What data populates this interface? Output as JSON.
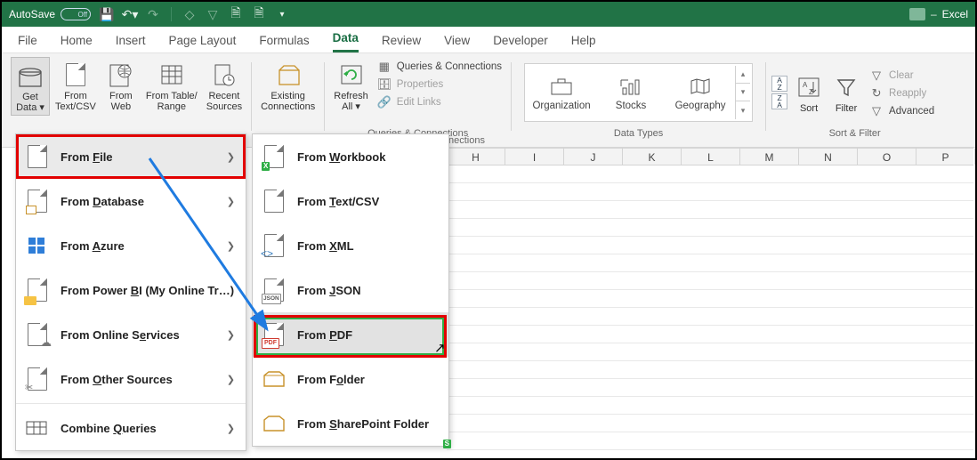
{
  "titlebar": {
    "autosave_label": "AutoSave",
    "autosave_state": "Off",
    "app_name": "Excel"
  },
  "tabs": [
    "File",
    "Home",
    "Insert",
    "Page Layout",
    "Formulas",
    "Data",
    "Review",
    "View",
    "Developer",
    "Help"
  ],
  "active_tab_index": 5,
  "ribbon": {
    "get_transform": {
      "get_data": "Get\nData ▾",
      "from_textcsv": "From\nText/CSV",
      "from_web": "From\nWeb",
      "from_table": "From Table/\nRange",
      "recent_sources": "Recent\nSources",
      "existing_conn": "Existing\nConnections"
    },
    "refresh": {
      "refresh_all": "Refresh\nAll ▾",
      "queries": "Queries & Connections",
      "properties": "Properties",
      "edit_links": "Edit Links",
      "caption": "Queries & Connections"
    },
    "data_types": {
      "items": [
        {
          "label": "Organization"
        },
        {
          "label": "Stocks"
        },
        {
          "label": "Geography"
        }
      ],
      "caption": "Data Types"
    },
    "sort_filter": {
      "sort": "Sort",
      "filter": "Filter",
      "clear": "Clear",
      "reapply": "Reapply",
      "advanced": "Advanced",
      "caption": "Sort & Filter"
    },
    "connections_caption": "nections"
  },
  "cols": [
    "H",
    "I",
    "J",
    "K",
    "L",
    "M",
    "N",
    "O",
    "P"
  ],
  "menu1": [
    {
      "label_pre": "From ",
      "u": "F",
      "label_post": "ile",
      "chev": true,
      "hl": true
    },
    {
      "label_pre": "From ",
      "u": "D",
      "label_post": "atabase",
      "chev": true
    },
    {
      "label_pre": "From ",
      "u": "A",
      "label_post": "zure",
      "chev": true
    },
    {
      "label_pre": "From Power ",
      "u": "B",
      "label_post": "I (My Online Tr…)"
    },
    {
      "label_pre": "From Online S",
      "u": "e",
      "label_post": "rvices",
      "chev": true
    },
    {
      "label_pre": "From ",
      "u": "O",
      "label_post": "ther Sources",
      "chev": true
    },
    {
      "label_pre": "Combine ",
      "u": "Q",
      "label_post": "ueries",
      "chev": true
    }
  ],
  "menu2": [
    {
      "label_pre": "From ",
      "u": "W",
      "label_post": "orkbook"
    },
    {
      "label_pre": "From ",
      "u": "T",
      "label_post": "ext/CSV"
    },
    {
      "label_pre": "From ",
      "u": "X",
      "label_post": "ML"
    },
    {
      "label_pre": "From ",
      "u": "J",
      "label_post": "SON"
    },
    {
      "label_pre": "From ",
      "u": "P",
      "label_post": "DF",
      "hl": true
    },
    {
      "label_pre": "From F",
      "u": "o",
      "label_post": "lder"
    },
    {
      "label_pre": "From ",
      "u": "S",
      "label_post": "harePoint Folder"
    }
  ]
}
